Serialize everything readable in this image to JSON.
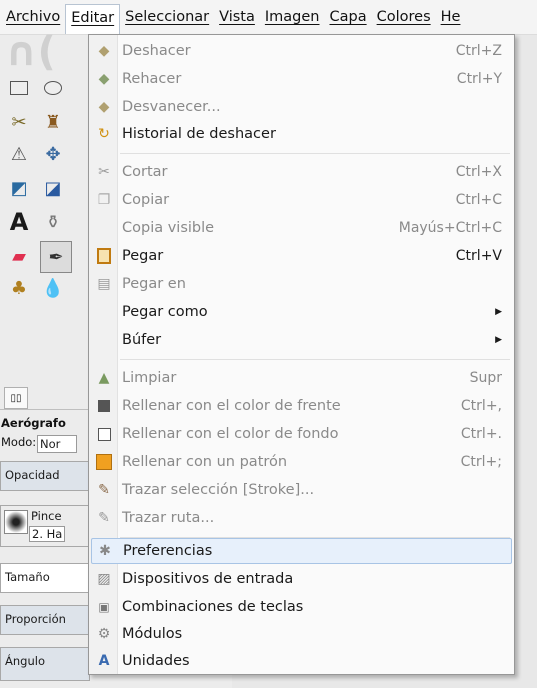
{
  "menubar": {
    "items": [
      {
        "label": "Archivo",
        "active": false
      },
      {
        "label": "Editar",
        "active": true
      },
      {
        "label": "Seleccionar",
        "active": false
      },
      {
        "label": "Vista",
        "active": false
      },
      {
        "label": "Imagen",
        "active": false
      },
      {
        "label": "Capa",
        "active": false
      },
      {
        "label": "Colores",
        "active": false
      },
      {
        "label": "He",
        "active": false
      }
    ]
  },
  "toolbox": {
    "tool_name": "Aerógrafo",
    "mode_label": "Modo:",
    "mode_value": "Nor",
    "opacity_label": "Opacidad",
    "brush_label": "Pince",
    "brush_value": "2. Ha",
    "size_label": "Tamaño",
    "ratio_label": "Proporción",
    "angle_label": "Ángulo"
  },
  "edit_menu": {
    "items": [
      {
        "id": "undo",
        "label": "Deshacer",
        "shortcut": "Ctrl+Z",
        "disabled": true,
        "icon": "undo-icon",
        "glyph": "⟲"
      },
      {
        "id": "redo",
        "label": "Rehacer",
        "shortcut": "Ctrl+Y",
        "disabled": true,
        "icon": "redo-icon",
        "glyph": "⟳"
      },
      {
        "id": "fade",
        "label": "Desvanecer...",
        "shortcut": "",
        "disabled": true,
        "icon": "fade-icon",
        "glyph": "⟲"
      },
      {
        "id": "undo-history",
        "label": "Historial de deshacer",
        "shortcut": "",
        "disabled": false,
        "icon": "history-icon",
        "glyph": "↺"
      },
      {
        "id": "cut",
        "label": "Cortar",
        "shortcut": "Ctrl+X",
        "disabled": true,
        "icon": "scissors-icon",
        "glyph": "✂"
      },
      {
        "id": "copy",
        "label": "Copiar",
        "shortcut": "Ctrl+C",
        "disabled": true,
        "icon": "copy-icon",
        "glyph": "❐"
      },
      {
        "id": "copy-visible",
        "label": "Copia visible",
        "shortcut": "Mayús+Ctrl+C",
        "disabled": true,
        "icon": "",
        "glyph": ""
      },
      {
        "id": "paste",
        "label": "Pegar",
        "shortcut": "Ctrl+V",
        "disabled": false,
        "icon": "paste-icon",
        "glyph": "▣"
      },
      {
        "id": "paste-into",
        "label": "Pegar en",
        "shortcut": "",
        "disabled": true,
        "icon": "paste-into-icon",
        "glyph": "▤"
      },
      {
        "id": "paste-as",
        "label": "Pegar como",
        "shortcut": "",
        "disabled": false,
        "submenu": true,
        "icon": "",
        "glyph": ""
      },
      {
        "id": "buffer",
        "label": "Búfer",
        "shortcut": "",
        "disabled": false,
        "submenu": true,
        "icon": "",
        "glyph": ""
      },
      {
        "id": "clear",
        "label": "Limpiar",
        "shortcut": "Supr",
        "disabled": true,
        "icon": "eraser-icon",
        "glyph": "⌂"
      },
      {
        "id": "fill-fg",
        "label": "Rellenar con el color de frente",
        "shortcut": "Ctrl+,",
        "disabled": true,
        "icon": "fill-fg-icon",
        "glyph": "■"
      },
      {
        "id": "fill-bg",
        "label": "Rellenar con el color de fondo",
        "shortcut": "Ctrl+.",
        "disabled": true,
        "icon": "fill-bg-icon",
        "glyph": "□"
      },
      {
        "id": "fill-pattern",
        "label": "Rellenar con un patrón",
        "shortcut": "Ctrl+;",
        "disabled": true,
        "icon": "pattern-icon",
        "glyph": "■"
      },
      {
        "id": "stroke-selection",
        "label": "Trazar selección [Stroke]...",
        "shortcut": "",
        "disabled": true,
        "icon": "stroke-selection-icon",
        "glyph": "✎"
      },
      {
        "id": "stroke-path",
        "label": "Trazar ruta...",
        "shortcut": "",
        "disabled": true,
        "icon": "stroke-path-icon",
        "glyph": "✎"
      },
      {
        "id": "preferences",
        "label": "Preferencias",
        "shortcut": "",
        "disabled": false,
        "highlighted": true,
        "icon": "preferences-icon",
        "glyph": "✱"
      },
      {
        "id": "input-devices",
        "label": "Dispositivos de entrada",
        "shortcut": "",
        "disabled": false,
        "icon": "input-devices-icon",
        "glyph": "▨"
      },
      {
        "id": "keyboard-shortcuts",
        "label": "Combinaciones de teclas",
        "shortcut": "",
        "disabled": false,
        "icon": "keyboard-icon",
        "glyph": "▣"
      },
      {
        "id": "modules",
        "label": "Módulos",
        "shortcut": "",
        "disabled": false,
        "icon": "modules-icon",
        "glyph": "⚙"
      },
      {
        "id": "units",
        "label": "Unidades",
        "shortcut": "",
        "disabled": false,
        "icon": "units-icon",
        "glyph": "A"
      }
    ]
  },
  "colors": {
    "highlight_bg": "#e7f0fb",
    "highlight_border": "#a8c4e5",
    "disabled_text": "#8a8a8a",
    "pattern_orange": "#f0a020",
    "paste_orange": "#e08a10"
  }
}
